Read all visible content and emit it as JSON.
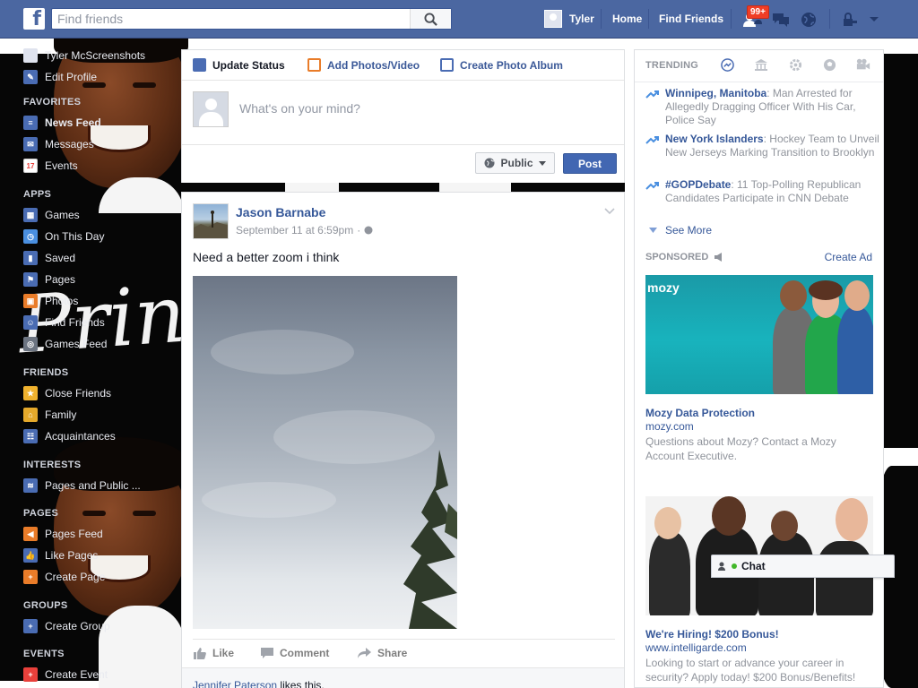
{
  "topbar": {
    "logo": "f",
    "search_placeholder": "Find friends",
    "user_name": "Tyler",
    "nav_home": "Home",
    "nav_find_friends": "Find Friends",
    "notif_badge": "99+"
  },
  "sidebar": {
    "profile_name": "Tyler McScreenshots",
    "edit_profile": "Edit Profile",
    "sections": [
      {
        "heading": "FAVORITES",
        "items": [
          "News Feed",
          "Messages",
          "Events"
        ]
      },
      {
        "heading": "APPS",
        "items": [
          "Games",
          "On This Day",
          "Saved",
          "Pages",
          "Photos",
          "Find Friends",
          "Games Feed"
        ]
      },
      {
        "heading": "FRIENDS",
        "items": [
          "Close Friends",
          "Family",
          "Acquaintances"
        ]
      },
      {
        "heading": "INTERESTS",
        "items": [
          "Pages and Public ..."
        ]
      },
      {
        "heading": "PAGES",
        "items": [
          "Pages Feed",
          "Like Pages",
          "Create Page"
        ]
      },
      {
        "heading": "GROUPS",
        "items": [
          "Create Group"
        ]
      },
      {
        "heading": "EVENTS",
        "items": [
          "Create Event"
        ]
      }
    ],
    "events_icon_label": "17"
  },
  "background": {
    "script_text": "Prince of Fame"
  },
  "composer": {
    "tab_status": "Update Status",
    "tab_photos": "Add Photos/Video",
    "tab_album": "Create Photo Album",
    "placeholder": "What's on your mind?",
    "privacy": "Public",
    "post_button": "Post"
  },
  "post": {
    "author": "Jason Barnabe",
    "timestamp": "September 11 at 6:59pm",
    "text": "Need a better zoom i think",
    "actions": [
      "Like",
      "Comment",
      "Share"
    ],
    "likes_name": "Jennifer Paterson",
    "likes_suffix": " likes this."
  },
  "trending": {
    "heading": "TRENDING",
    "items": [
      {
        "title": "Winnipeg, Manitoba",
        "desc": ": Man Arrested for Allegedly Dragging Officer With His Car, Police Say"
      },
      {
        "title": "New York Islanders",
        "desc": ": Hockey Team to Unveil New Jerseys Marking Transition to Brooklyn"
      },
      {
        "title": "#GOPDebate",
        "desc": ": 11 Top-Polling Republican Candidates Participate in CNN Debate"
      }
    ],
    "see_more": "See More"
  },
  "sponsored": {
    "heading": "SPONSORED",
    "create_ad": "Create Ad",
    "ads": [
      {
        "logo": "mozy",
        "title": "Mozy Data Protection",
        "url": "mozy.com",
        "desc": "Questions about Mozy? Contact a Mozy Account Executive."
      },
      {
        "title": "We're Hiring! $200 Bonus!",
        "url": "www.intelligarde.com",
        "desc": "Looking to start or advance your career in security? Apply today! $200 Bonus/Benefits!"
      }
    ]
  },
  "chat": {
    "label": "Chat"
  },
  "colors": {
    "topbar": "#4b67a1",
    "link": "#365899",
    "post_button": "#4267b2",
    "badge": "#f03d25"
  }
}
